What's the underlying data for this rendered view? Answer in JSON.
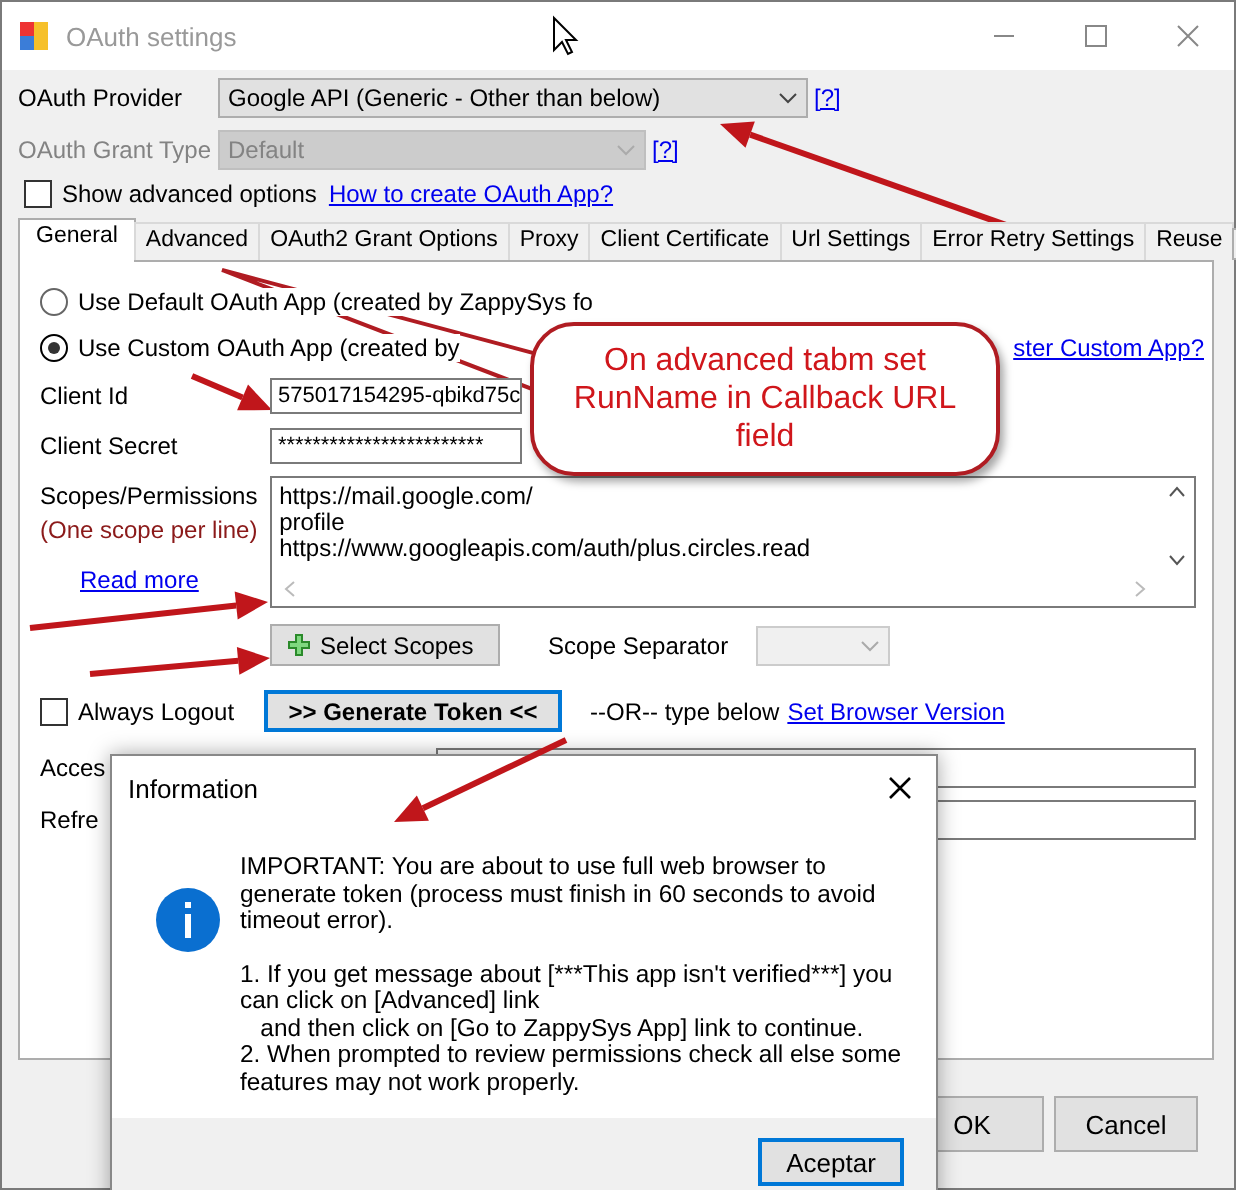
{
  "window": {
    "title": "OAuth settings"
  },
  "provider": {
    "label": "OAuth Provider",
    "value": "Google API (Generic - Other than below)",
    "help": "[?]"
  },
  "grant_type": {
    "label": "OAuth Grant Type",
    "value": "Default",
    "help": "[?]",
    "disabled": true
  },
  "advanced_options": {
    "label": "Show advanced options",
    "checked": false,
    "link": "How to create OAuth App?"
  },
  "tabs": [
    {
      "label": "General",
      "selected": true
    },
    {
      "label": "Advanced",
      "selected": false
    },
    {
      "label": "OAuth2 Grant Options",
      "selected": false
    },
    {
      "label": "Proxy",
      "selected": false
    },
    {
      "label": "Client Certificate",
      "selected": false
    },
    {
      "label": "Url Settings",
      "selected": false
    },
    {
      "label": "Error Retry Settings",
      "selected": false
    },
    {
      "label": "Reuse",
      "selected": false
    }
  ],
  "app_choice": [
    {
      "label": "Use Default OAuth App (created by ZappySys fo",
      "selected": false
    },
    {
      "label": "Use Custom OAuth App (created by",
      "selected": true
    }
  ],
  "register_link": "ster Custom App?",
  "client_id": {
    "label": "Client Id",
    "value": "575017154295-qbikd75c"
  },
  "client_secret": {
    "label": "Client Secret",
    "value": "************************"
  },
  "scopes": {
    "label": "Scopes/Permissions",
    "hint": "(One scope per line)",
    "link": "Read more",
    "lines": [
      "https://mail.google.com/",
      "profile",
      "https://www.googleapis.com/auth/plus.circles.read"
    ]
  },
  "select_scopes": "Select Scopes",
  "scope_separator": {
    "label": "Scope Separator"
  },
  "always_logout": {
    "label": "Always Logout",
    "checked": false
  },
  "generate": ">> Generate Token <<",
  "or_text": "--OR-- type below",
  "browser_link": "Set Browser Version",
  "access_label": "Acces",
  "refresh_label": "Refre",
  "buttons": [
    "OK",
    "Cancel"
  ],
  "callout": "On advanced tabm set RunName in Callback URL field",
  "dialog": {
    "title": "Information",
    "paragraphs": [
      "IMPORTANT: You are about to use full web browser to generate token (process must finish in 60 seconds to avoid timeout error).",
      "1. If you get message about [***This app isn't verified***] you can click on [Advanced] link\n   and then click on [Go to ZappySys App] link to continue.\n2. When prompted to review permissions check all else some features may not work properly."
    ],
    "button": "Aceptar"
  }
}
